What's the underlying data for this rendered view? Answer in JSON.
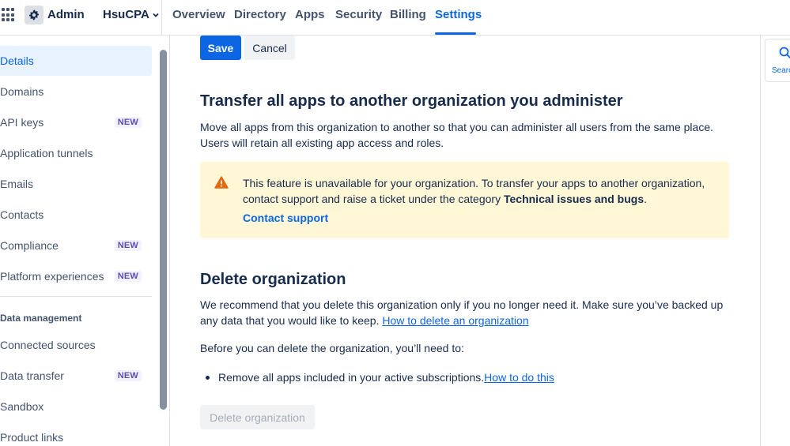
{
  "header": {
    "app_name": "Admin",
    "org_name": "HsuCPA",
    "tabs": [
      {
        "label": "Overview"
      },
      {
        "label": "Directory"
      },
      {
        "label": "Apps"
      },
      {
        "label": "Security"
      },
      {
        "label": "Billing"
      },
      {
        "label": "Settings",
        "active": true
      }
    ]
  },
  "sidebar": {
    "items": [
      {
        "label": "Details",
        "selected": true
      },
      {
        "label": "Domains"
      },
      {
        "label": "API keys",
        "badge": "NEW"
      },
      {
        "label": "Application tunnels"
      },
      {
        "label": "Emails"
      },
      {
        "label": "Contacts"
      },
      {
        "label": "Compliance",
        "badge": "NEW"
      },
      {
        "label": "Platform experiences",
        "badge": "NEW"
      }
    ],
    "section_heading": "Data management",
    "section_items": [
      {
        "label": "Connected sources"
      },
      {
        "label": "Data transfer",
        "badge": "NEW"
      },
      {
        "label": "Sandbox"
      },
      {
        "label": "Product links"
      }
    ]
  },
  "form": {
    "save_label": "Save",
    "cancel_label": "Cancel"
  },
  "transfer": {
    "title": "Transfer all apps to another organization you administer",
    "description": "Move all apps from this organization to another so that you can administer all users from the same place. Users will retain all existing app access and roles.",
    "warning_text_1": "This feature is unavailable for your organization. To transfer your apps to another organization, contact support and raise a ticket under the category ",
    "warning_bold": "Technical issues and bugs",
    "warning_text_2": ".",
    "warning_link": "Contact support"
  },
  "delete": {
    "title": "Delete organization",
    "description": "We recommend that you delete this organization only if you no longer need it. Make sure you’ve backed up any data that you would like to keep. ",
    "description_link": "How to delete an organization",
    "prereq": "Before you can delete the organization, you’ll need to:",
    "bullet_text": "Remove all apps included in your active subscriptions. ",
    "bullet_link": "How to do this",
    "button_label": "Delete organization"
  },
  "right_panel": {
    "search_label": "Searc"
  },
  "colors": {
    "primary": "#0c66e4",
    "warning_bg": "#fff7d6",
    "warning_icon": "#e56910",
    "badge_bg": "#f3f0ff",
    "badge_text": "#5e4db2"
  }
}
